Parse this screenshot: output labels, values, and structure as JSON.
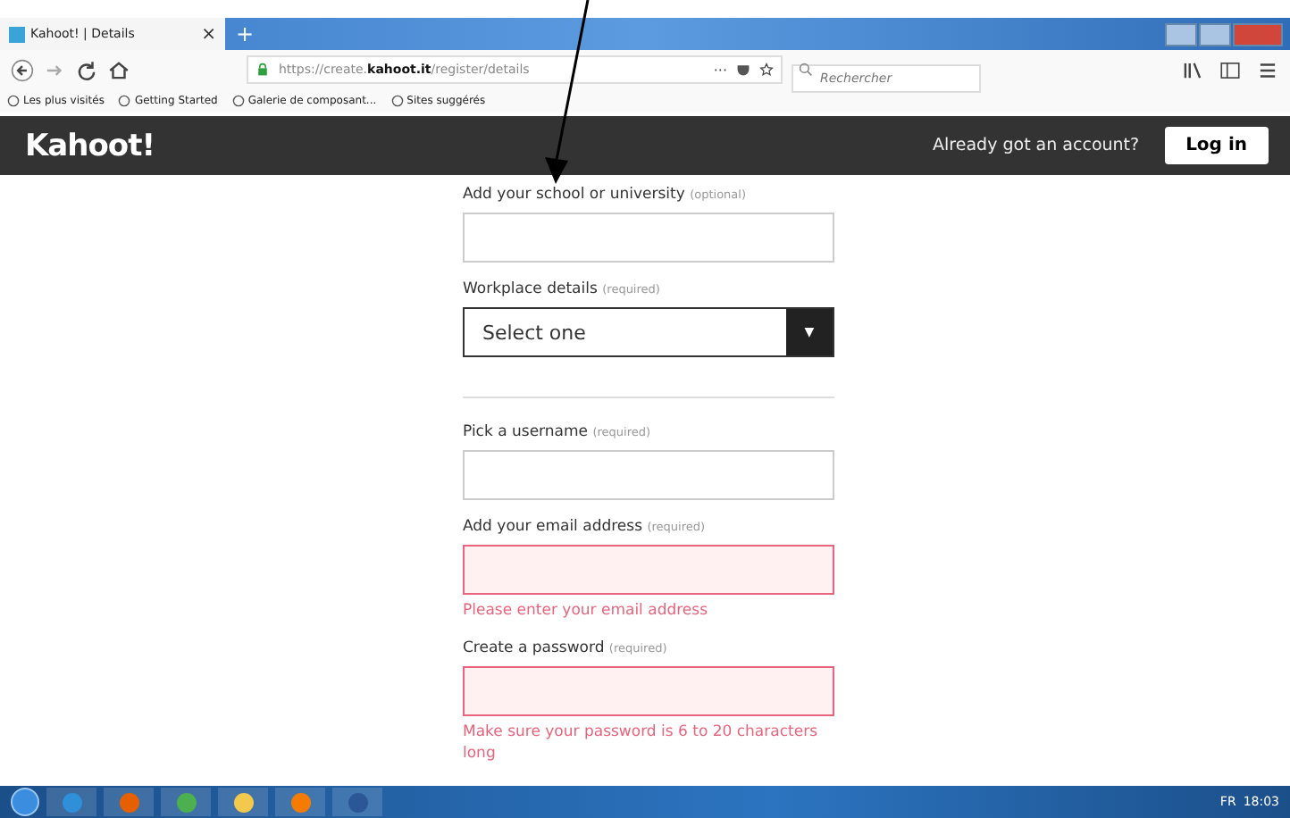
{
  "browser": {
    "tab_title": "Kahoot! | Details",
    "tab_close": "×",
    "new_tab": "+",
    "url_prefix": "https://create.",
    "url_domain": "kahoot.it",
    "url_path": "/register/details",
    "page_actions": "···",
    "search_placeholder": "Rechercher",
    "bookmarks": [
      "Les plus visités",
      "Getting Started",
      "Galerie de composant...",
      "Sites suggérés"
    ]
  },
  "header": {
    "logo": "Kahoot!",
    "account_prompt": "Already got an account?",
    "login_button": "Log in"
  },
  "form": [
    {
      "kind": "text",
      "label": "Add your school or university",
      "tag": "(optional)",
      "error": false
    },
    {
      "kind": "select",
      "label": "Workplace details",
      "tag": "(required)",
      "value": "Select one",
      "caret": "▼",
      "error": false
    },
    {
      "kind": "divider"
    },
    {
      "kind": "text",
      "label": "Pick a username",
      "tag": "(required)",
      "error": false
    },
    {
      "kind": "text",
      "label": "Add your email address",
      "tag": "(required)",
      "error": true,
      "message": "Please enter your email address"
    },
    {
      "kind": "text",
      "label": "Create a password",
      "tag": "(required)",
      "error": true,
      "message": "Make sure your password is 6 to 20 characters long"
    }
  ],
  "taskbar": {
    "apps": [
      {
        "color": "#2f8fd8"
      },
      {
        "color": "#e66000"
      },
      {
        "color": "#4caf50"
      },
      {
        "color": "#f2c94c"
      },
      {
        "color": "#f57c00"
      },
      {
        "color": "#2b5797"
      }
    ],
    "language": "FR",
    "time": "18:03"
  }
}
